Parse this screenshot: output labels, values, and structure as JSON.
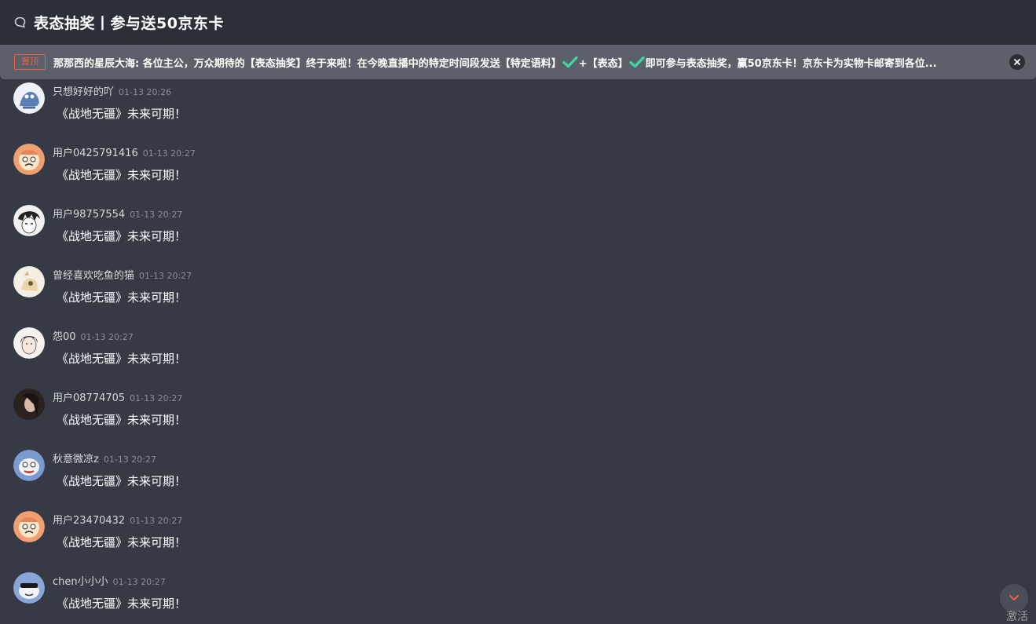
{
  "header": {
    "title": "表态抽奖丨参与送50京东卡"
  },
  "pinned": {
    "badge": "置顶",
    "text_part1": "那那西的星辰大海: 各位主公，万众期待的【表态抽奖】终于来啦！在今晚直播中的特定时间段发送【特定语料】",
    "text_part2": "+【表态】",
    "text_part3": "即可参与表态抽奖，赢50京东卡！京东卡为实物卡邮寄到各位...",
    "check_color": "#3ed6a0"
  },
  "messages": [
    {
      "username": "只想好好的吖",
      "time": "01-13 20:26",
      "text": "《战地无疆》未来可期！",
      "avatar_color": "#5a7fb5"
    },
    {
      "username": "用户0425791416",
      "time": "01-13 20:27",
      "text": "《战地无疆》未来可期！",
      "avatar_color": "#e8845a"
    },
    {
      "username": "用户98757554",
      "time": "01-13 20:27",
      "text": "《战地无疆》未来可期！",
      "avatar_color": "#3a3a3a"
    },
    {
      "username": "曾经喜欢吃鱼的猫",
      "time": "01-13 20:27",
      "text": "《战地无疆》未来可期！",
      "avatar_color": "#d9c9a0"
    },
    {
      "username": "怨00",
      "time": "01-13 20:27",
      "text": "《战地无疆》未来可期！",
      "avatar_color": "#e8e0d8"
    },
    {
      "username": "用户08774705",
      "time": "01-13 20:27",
      "text": "《战地无疆》未来可期！",
      "avatar_color": "#4a3a34"
    },
    {
      "username": "秋意微凉z",
      "time": "01-13 20:27",
      "text": "《战地无疆》未来可期！",
      "avatar_color": "#6a8ac0"
    },
    {
      "username": "用户23470432",
      "time": "01-13 20:27",
      "text": "《战地无疆》未来可期！",
      "avatar_color": "#e8845a"
    },
    {
      "username": "chen小小小",
      "time": "01-13 20:27",
      "text": "《战地无疆》未来可期！",
      "avatar_color": "#7a9ad0"
    }
  ],
  "corner_text": "激活",
  "colors": {
    "background": "#363a44",
    "header": "#2c2f37",
    "pinned_bar": "#5c606a",
    "accent": "#ef5b3d"
  }
}
